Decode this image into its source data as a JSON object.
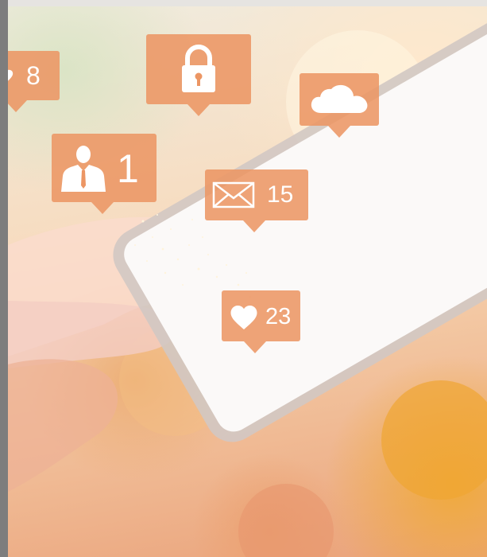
{
  "colors": {
    "bubble": "#ec9664",
    "icon": "#ffffff",
    "background_warm": "#f3c7a2",
    "accent_orange": "#f0aa37"
  },
  "notifications": {
    "partial_badge": {
      "icon": "heart-icon",
      "count": "8"
    },
    "lock": {
      "icon": "lock-icon"
    },
    "cloud": {
      "icon": "cloud-icon"
    },
    "user": {
      "icon": "user-icon",
      "count": "1"
    },
    "mail": {
      "icon": "envelope-icon",
      "count": "15"
    },
    "likes": {
      "icon": "heart-icon",
      "count": "23"
    }
  }
}
